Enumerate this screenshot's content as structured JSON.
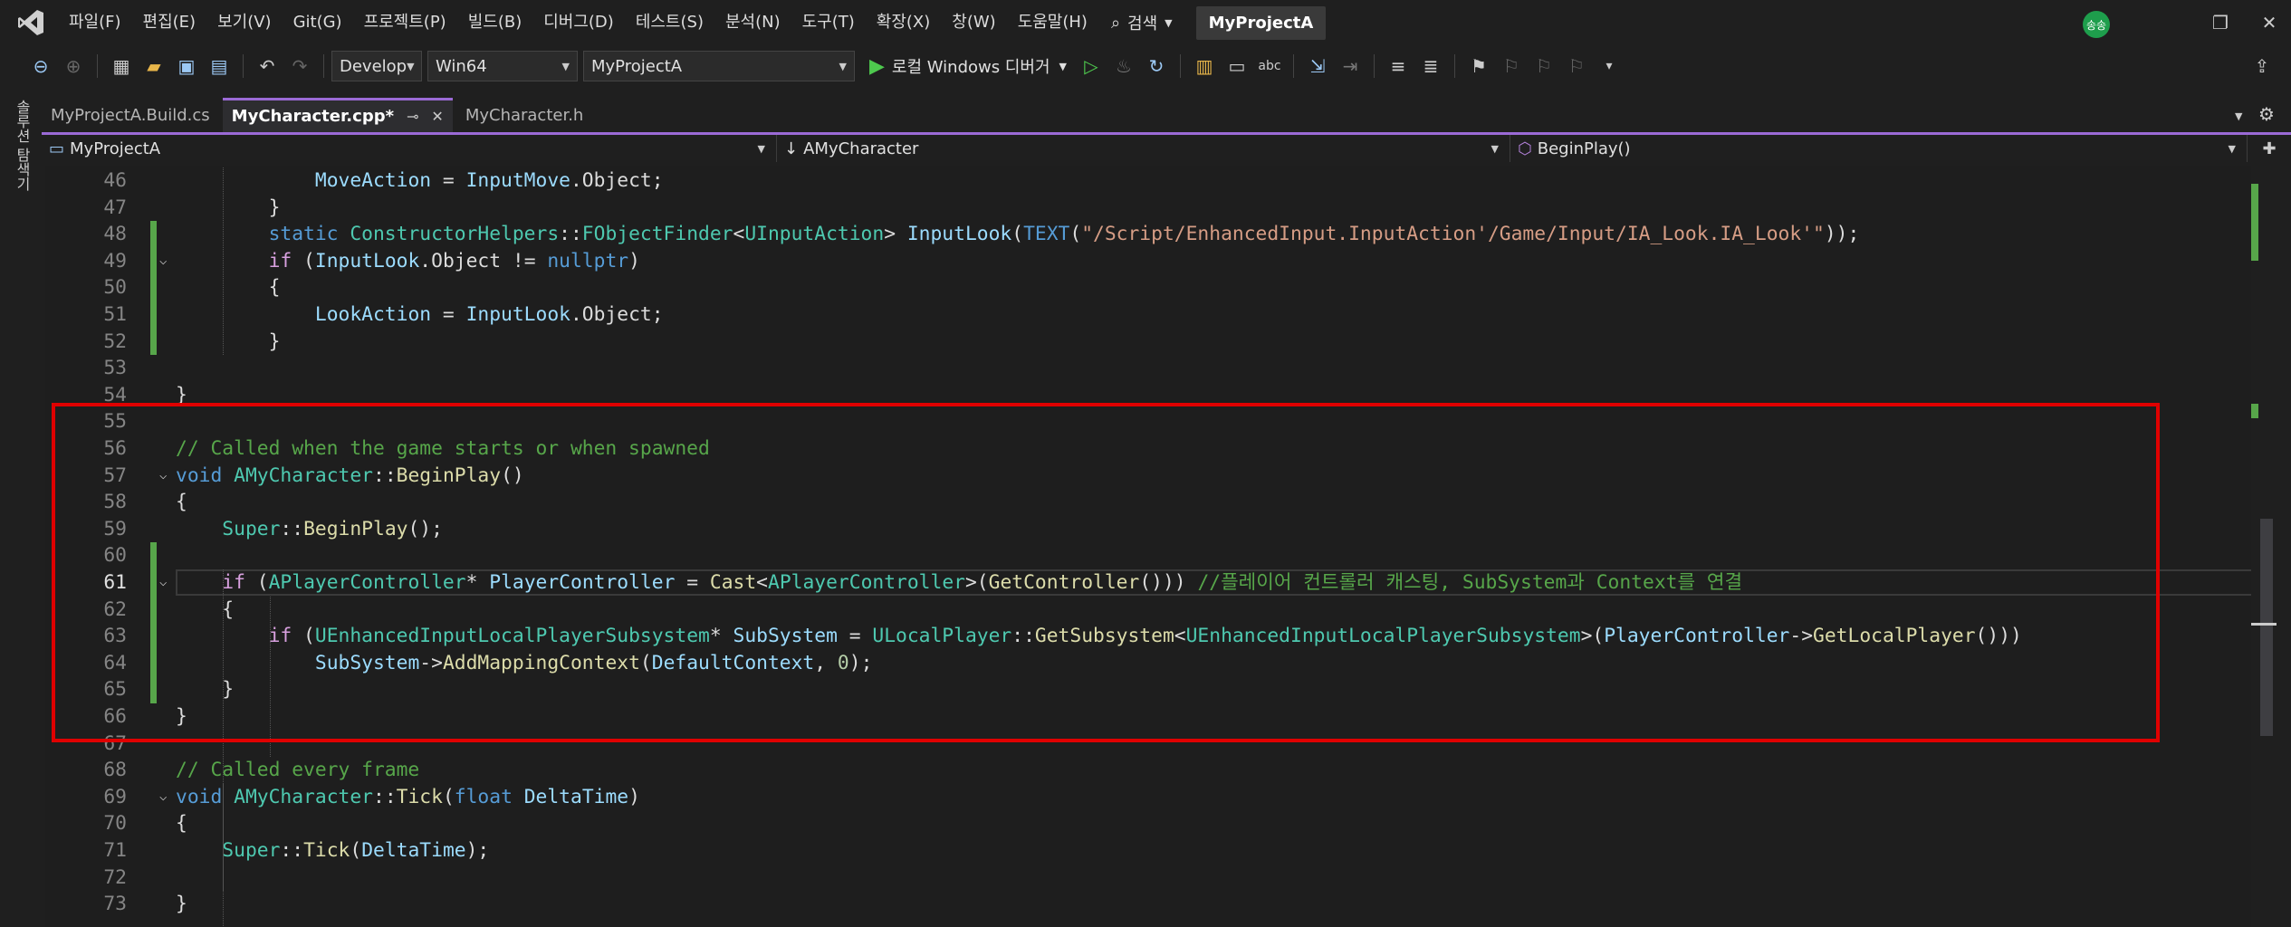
{
  "menu": {
    "items": [
      "파일(F)",
      "편집(E)",
      "보기(V)",
      "Git(G)",
      "프로젝트(P)",
      "빌드(B)",
      "디버그(D)",
      "테스트(S)",
      "분석(N)",
      "도구(T)",
      "확장(X)",
      "창(W)",
      "도움말(H)"
    ],
    "search_label": "검색",
    "project_badge": "MyProjectA",
    "avatar_initials": "송송"
  },
  "toolbar": {
    "config": "Develop",
    "platform": "Win64",
    "startup_project": "MyProjectA",
    "run_label": "로컬 Windows 디버거"
  },
  "side_panel": {
    "label": "솔루션 탐색기"
  },
  "tabs": [
    {
      "label": "MyProjectA.Build.cs",
      "active": false
    },
    {
      "label": "MyCharacter.cpp*",
      "active": true
    },
    {
      "label": "MyCharacter.h",
      "active": false
    }
  ],
  "nav": {
    "project": "MyProjectA",
    "scope": "AMyCharacter",
    "member": "BeginPlay()"
  },
  "current_line": 61,
  "colors": {
    "accent": "#9b6ad6",
    "highlight_box": "#e00000",
    "changed_marker": "#57a64a",
    "editor_bg": "#1e1e1e"
  },
  "code": [
    {
      "n": 46,
      "t": [
        [
          "pl",
          "            "
        ],
        [
          "vr",
          "MoveAction"
        ],
        [
          "pl",
          " = "
        ],
        [
          "vr",
          "InputMove"
        ],
        [
          "pl",
          ".Object;"
        ]
      ]
    },
    {
      "n": 47,
      "t": [
        [
          "pl",
          "        }"
        ]
      ]
    },
    {
      "n": 48,
      "t": [
        [
          "pl",
          "        "
        ],
        [
          "kw",
          "static"
        ],
        [
          "pl",
          " "
        ],
        [
          "ty",
          "ConstructorHelpers"
        ],
        [
          "pl",
          "::"
        ],
        [
          "ty",
          "FObjectFinder"
        ],
        [
          "pl",
          "<"
        ],
        [
          "ty",
          "UInputAction"
        ],
        [
          "pl",
          "> "
        ],
        [
          "vr",
          "InputLook"
        ],
        [
          "pl",
          "("
        ],
        [
          "mc",
          "TEXT"
        ],
        [
          "pl",
          "("
        ],
        [
          "st",
          "\"/Script/EnhancedInput.InputAction'/Game/Input/IA_Look.IA_Look'\""
        ],
        [
          "pl",
          "));"
        ]
      ]
    },
    {
      "n": 49,
      "t": [
        [
          "pl",
          "        "
        ],
        [
          "ctl",
          "if"
        ],
        [
          "pl",
          " ("
        ],
        [
          "vr",
          "InputLook"
        ],
        [
          "pl",
          ".Object != "
        ],
        [
          "kw",
          "nullptr"
        ],
        [
          "pl",
          ")"
        ]
      ]
    },
    {
      "n": 50,
      "t": [
        [
          "pl",
          "        {"
        ]
      ]
    },
    {
      "n": 51,
      "t": [
        [
          "pl",
          "            "
        ],
        [
          "vr",
          "LookAction"
        ],
        [
          "pl",
          " = "
        ],
        [
          "vr",
          "InputLook"
        ],
        [
          "pl",
          ".Object;"
        ]
      ]
    },
    {
      "n": 52,
      "t": [
        [
          "pl",
          "        }"
        ]
      ]
    },
    {
      "n": 53,
      "t": []
    },
    {
      "n": 54,
      "t": [
        [
          "pl",
          "}"
        ]
      ]
    },
    {
      "n": 55,
      "t": []
    },
    {
      "n": 56,
      "t": [
        [
          "cm",
          "// Called when the game starts or when spawned"
        ]
      ]
    },
    {
      "n": 57,
      "t": [
        [
          "kw",
          "void"
        ],
        [
          "pl",
          " "
        ],
        [
          "ty",
          "AMyCharacter"
        ],
        [
          "pl",
          "::"
        ],
        [
          "fn",
          "BeginPlay"
        ],
        [
          "pl",
          "()"
        ]
      ]
    },
    {
      "n": 58,
      "t": [
        [
          "pl",
          "{"
        ]
      ]
    },
    {
      "n": 59,
      "t": [
        [
          "pl",
          "    "
        ],
        [
          "ty",
          "Super"
        ],
        [
          "pl",
          "::"
        ],
        [
          "fn",
          "BeginPlay"
        ],
        [
          "pl",
          "();"
        ]
      ]
    },
    {
      "n": 60,
      "t": []
    },
    {
      "n": 61,
      "t": [
        [
          "pl",
          "    "
        ],
        [
          "ctl",
          "if"
        ],
        [
          "pl",
          " ("
        ],
        [
          "ty",
          "APlayerController"
        ],
        [
          "pl",
          "* "
        ],
        [
          "vr",
          "PlayerController"
        ],
        [
          "pl",
          " = "
        ],
        [
          "fn",
          "Cast"
        ],
        [
          "pl",
          "<"
        ],
        [
          "ty",
          "APlayerController"
        ],
        [
          "pl",
          ">("
        ],
        [
          "fn",
          "GetController"
        ],
        [
          "pl",
          "())) "
        ],
        [
          "cm",
          "//플레이어 컨트롤러 캐스팅, SubSystem과 Context를 연결"
        ]
      ]
    },
    {
      "n": 62,
      "t": [
        [
          "pl",
          "    {"
        ]
      ]
    },
    {
      "n": 63,
      "t": [
        [
          "pl",
          "        "
        ],
        [
          "ctl",
          "if"
        ],
        [
          "pl",
          " ("
        ],
        [
          "ty",
          "UEnhancedInputLocalPlayerSubsystem"
        ],
        [
          "pl",
          "* "
        ],
        [
          "vr",
          "SubSystem"
        ],
        [
          "pl",
          " = "
        ],
        [
          "ty",
          "ULocalPlayer"
        ],
        [
          "pl",
          "::"
        ],
        [
          "fn",
          "GetSubsystem"
        ],
        [
          "pl",
          "<"
        ],
        [
          "ty",
          "UEnhancedInputLocalPlayerSubsystem"
        ],
        [
          "pl",
          ">("
        ],
        [
          "vr",
          "PlayerController"
        ],
        [
          "pl",
          "->"
        ],
        [
          "fn",
          "GetLocalPlayer"
        ],
        [
          "pl",
          "()))"
        ]
      ]
    },
    {
      "n": 64,
      "t": [
        [
          "pl",
          "            "
        ],
        [
          "vr",
          "SubSystem"
        ],
        [
          "pl",
          "->"
        ],
        [
          "fn",
          "AddMappingContext"
        ],
        [
          "pl",
          "("
        ],
        [
          "vr",
          "DefaultContext"
        ],
        [
          "pl",
          ", "
        ],
        [
          "nm",
          "0"
        ],
        [
          "pl",
          ");"
        ]
      ]
    },
    {
      "n": 65,
      "t": [
        [
          "pl",
          "    }"
        ]
      ]
    },
    {
      "n": 66,
      "t": [
        [
          "pl",
          "}"
        ]
      ]
    },
    {
      "n": 67,
      "t": []
    },
    {
      "n": 68,
      "t": [
        [
          "cm",
          "// Called every frame"
        ]
      ]
    },
    {
      "n": 69,
      "t": [
        [
          "kw",
          "void"
        ],
        [
          "pl",
          " "
        ],
        [
          "ty",
          "AMyCharacter"
        ],
        [
          "pl",
          "::"
        ],
        [
          "fn",
          "Tick"
        ],
        [
          "pl",
          "("
        ],
        [
          "kw",
          "float"
        ],
        [
          "pl",
          " "
        ],
        [
          "vr",
          "DeltaTime"
        ],
        [
          "pl",
          ")"
        ]
      ]
    },
    {
      "n": 70,
      "t": [
        [
          "pl",
          "{"
        ]
      ]
    },
    {
      "n": 71,
      "t": [
        [
          "pl",
          "    "
        ],
        [
          "ty",
          "Super"
        ],
        [
          "pl",
          "::"
        ],
        [
          "fn",
          "Tick"
        ],
        [
          "pl",
          "("
        ],
        [
          "vr",
          "DeltaTime"
        ],
        [
          "pl",
          ");"
        ]
      ]
    },
    {
      "n": 72,
      "t": []
    },
    {
      "n": 73,
      "t": [
        [
          "pl",
          "}"
        ]
      ]
    }
  ]
}
